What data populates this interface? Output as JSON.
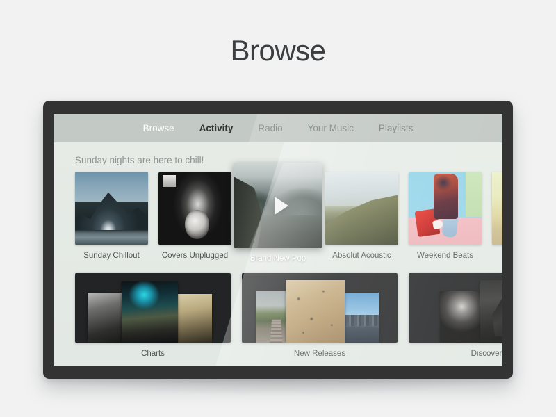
{
  "page": {
    "title": "Browse",
    "background_color": "#f2f2f2"
  },
  "device": {
    "bezel_color": "#333334",
    "screen_bg": "#e4eae4"
  },
  "nav": {
    "tabs": [
      {
        "label": "Browse",
        "state": "light"
      },
      {
        "label": "Activity",
        "state": "active"
      },
      {
        "label": "Radio",
        "state": "normal"
      },
      {
        "label": "Your Music",
        "state": "normal"
      },
      {
        "label": "Playlists",
        "state": "normal"
      }
    ],
    "bar_color": "#c3c9c5",
    "active_color": "#2f3331",
    "inactive_color": "#7c8481"
  },
  "main": {
    "greeting": "Sunday nights are here to chill!",
    "row1": {
      "cards": [
        {
          "title": "Sunday Chillout",
          "art": "mountain-lake-photo"
        },
        {
          "title": "Covers Unplugged",
          "art": "banjo-player-bw-photo"
        },
        {
          "title": "Absolut Acoustic",
          "art": "green-hill-photo"
        },
        {
          "title": "Weekend Beats",
          "art": "fashion-studio-photo"
        },
        {
          "title": "",
          "art": "cream-gradient-partial"
        }
      ],
      "featured": {
        "title": "Brand New Pop",
        "art": "mountain-valley-photo",
        "play_icon": "play-triangle-icon"
      }
    },
    "row2": {
      "panels": [
        {
          "title": "Charts",
          "art": "coverflow-neon-portrait"
        },
        {
          "title": "New Releases",
          "art": "coverflow-cork-city"
        },
        {
          "title": "Discover",
          "art": "coverflow-concert-bw"
        }
      ]
    }
  }
}
